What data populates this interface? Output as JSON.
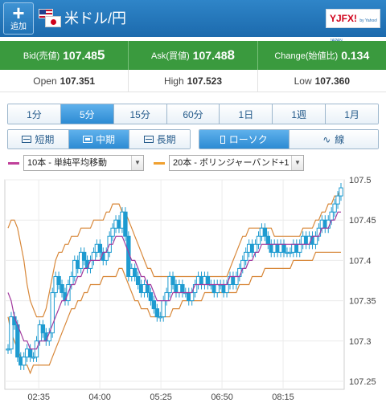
{
  "header": {
    "add_label": "追加",
    "add_glyph": "+",
    "pair": "米ドル/円",
    "logo_text": "YJFX!",
    "logo_small": "by Yahoo! JAPAN"
  },
  "prices": {
    "bid_label": "Bid(売値)",
    "bid_main": "107.48",
    "bid_pip": "5",
    "ask_label": "Ask(買値)",
    "ask_main": "107.48",
    "ask_pip": "8",
    "change_label": "Change(始値比)",
    "change_value": "0.134"
  },
  "ohl": {
    "open_label": "Open",
    "open_main": "107.35",
    "open_pip": "1",
    "high_label": "High",
    "high_main": "107.52",
    "high_pip": "3",
    "low_label": "Low",
    "low_main": "107.36",
    "low_pip": "0"
  },
  "timeframes": [
    "1分",
    "5分",
    "15分",
    "60分",
    "1日",
    "1週",
    "1月"
  ],
  "timeframe_selected": "5分",
  "periods": [
    "短期",
    "中期",
    "長期"
  ],
  "period_selected": "中期",
  "chart_types": [
    "ローソク",
    "線"
  ],
  "chart_type_selected": "ローソク",
  "indicators": [
    {
      "label": "10本 - 単純平均移動",
      "color": "#c0409a"
    },
    {
      "label": "20本 - ボリンジャーバンド+1",
      "color": "#f0a030"
    }
  ],
  "colors": {
    "accent_blue": "#2d8bd3",
    "price_green": "#3a9a3e",
    "candle": "#1e9bd0",
    "sma": "#a23a9e",
    "band": "#d8883a"
  },
  "chart_data": {
    "type": "candlestick",
    "title": "",
    "x_labels": [
      "02:35",
      "04:00",
      "05:25",
      "06:50",
      "08:15"
    ],
    "y_ticks": [
      107.25,
      107.3,
      107.35,
      107.4,
      107.45,
      107.5
    ],
    "ylim": [
      107.24,
      107.5
    ],
    "grid": true,
    "close": [
      107.29,
      107.33,
      107.32,
      107.28,
      107.27,
      107.28,
      107.29,
      107.28,
      107.28,
      107.3,
      107.32,
      107.31,
      107.3,
      107.31,
      107.36,
      107.38,
      107.37,
      107.36,
      107.35,
      107.37,
      107.38,
      107.4,
      107.39,
      107.41,
      107.4,
      107.39,
      107.4,
      107.41,
      107.42,
      107.41,
      107.4,
      107.41,
      107.43,
      107.44,
      107.45,
      107.44,
      107.46,
      107.43,
      107.38,
      107.39,
      107.38,
      107.37,
      107.36,
      107.37,
      107.36,
      107.35,
      107.34,
      107.33,
      107.33,
      107.35,
      107.36,
      107.38,
      107.37,
      107.36,
      107.37,
      107.36,
      107.36,
      107.35,
      107.36,
      107.37,
      107.38,
      107.37,
      107.38,
      107.37,
      107.37,
      107.36,
      107.37,
      107.37,
      107.36,
      107.37,
      107.38,
      107.37,
      107.38,
      107.39,
      107.4,
      107.41,
      107.42,
      107.41,
      107.42,
      107.43,
      107.44,
      107.43,
      107.42,
      107.41,
      107.42,
      107.41,
      107.42,
      107.41,
      107.41,
      107.41,
      107.42,
      107.41,
      107.42,
      107.43,
      107.42,
      107.43,
      107.42,
      107.43,
      107.44,
      107.45,
      107.44,
      107.45,
      107.46,
      107.47,
      107.48,
      107.49
    ],
    "sma": [
      107.36,
      107.35,
      107.33,
      107.32,
      107.31,
      107.3,
      107.3,
      107.29,
      107.29,
      107.29,
      107.3,
      107.3,
      107.3,
      107.31,
      107.32,
      107.33,
      107.34,
      107.35,
      107.35,
      107.36,
      107.37,
      107.37,
      107.38,
      107.38,
      107.39,
      107.39,
      107.4,
      107.4,
      107.4,
      107.4,
      107.41,
      107.41,
      107.42,
      107.42,
      107.43,
      107.43,
      107.43,
      107.42,
      107.41,
      107.4,
      107.4,
      107.39,
      107.38,
      107.38,
      107.37,
      107.37,
      107.36,
      107.35,
      107.35,
      107.35,
      107.35,
      107.35,
      107.36,
      107.36,
      107.36,
      107.36,
      107.36,
      107.36,
      107.36,
      107.37,
      107.37,
      107.37,
      107.37,
      107.37,
      107.37,
      107.37,
      107.37,
      107.37,
      107.37,
      107.37,
      107.38,
      107.38,
      107.38,
      107.38,
      107.39,
      107.39,
      107.4,
      107.4,
      107.41,
      107.41,
      107.42,
      107.42,
      107.42,
      107.42,
      107.42,
      107.42,
      107.42,
      107.42,
      107.42,
      107.42,
      107.42,
      107.42,
      107.42,
      107.42,
      107.42,
      107.42,
      107.43,
      107.43,
      107.43,
      107.44,
      107.44,
      107.44,
      107.45,
      107.45,
      107.46,
      107.46
    ],
    "band_upper": [
      107.44,
      107.45,
      107.45,
      107.44,
      107.42,
      107.4,
      107.37,
      107.35,
      107.34,
      107.33,
      107.33,
      107.33,
      107.34,
      107.36,
      107.38,
      107.4,
      107.41,
      107.41,
      107.42,
      107.42,
      107.43,
      107.43,
      107.43,
      107.44,
      107.44,
      107.44,
      107.44,
      107.45,
      107.45,
      107.45,
      107.45,
      107.46,
      107.46,
      107.47,
      107.47,
      107.47,
      107.46,
      107.46,
      107.45,
      107.44,
      107.43,
      107.42,
      107.41,
      107.4,
      107.39,
      107.39,
      107.38,
      107.38,
      107.38,
      107.38,
      107.38,
      107.38,
      107.38,
      107.38,
      107.38,
      107.38,
      107.38,
      107.38,
      107.38,
      107.38,
      107.38,
      107.38,
      107.38,
      107.38,
      107.38,
      107.38,
      107.38,
      107.38,
      107.38,
      107.38,
      107.39,
      107.4,
      107.41,
      107.42,
      107.43,
      107.43,
      107.44,
      107.44,
      107.44,
      107.44,
      107.44,
      107.44,
      107.44,
      107.44,
      107.43,
      107.43,
      107.43,
      107.43,
      107.43,
      107.43,
      107.43,
      107.43,
      107.43,
      107.44,
      107.44,
      107.44,
      107.44,
      107.45,
      107.45,
      107.46,
      107.46,
      107.47,
      107.47,
      107.48,
      107.48,
      107.49
    ],
    "band_lower": [
      107.33,
      107.31,
      107.3,
      107.29,
      107.28,
      107.27,
      107.27,
      107.26,
      107.27,
      107.27,
      107.27,
      107.27,
      107.27,
      107.27,
      107.28,
      107.29,
      107.3,
      107.31,
      107.32,
      107.33,
      107.34,
      107.34,
      107.35,
      107.35,
      107.36,
      107.36,
      107.37,
      107.37,
      107.37,
      107.37,
      107.38,
      107.38,
      107.38,
      107.38,
      107.38,
      107.39,
      107.39,
      107.38,
      107.37,
      107.36,
      107.35,
      107.35,
      107.34,
      107.34,
      107.34,
      107.33,
      107.33,
      107.33,
      107.33,
      107.33,
      107.33,
      107.33,
      107.34,
      107.34,
      107.34,
      107.35,
      107.35,
      107.35,
      107.35,
      107.35,
      107.35,
      107.35,
      107.36,
      107.36,
      107.36,
      107.36,
      107.36,
      107.36,
      107.36,
      107.36,
      107.36,
      107.36,
      107.36,
      107.37,
      107.37,
      107.37,
      107.37,
      107.38,
      107.38,
      107.38,
      107.38,
      107.39,
      107.39,
      107.39,
      107.39,
      107.39,
      107.39,
      107.39,
      107.39,
      107.39,
      107.4,
      107.4,
      107.4,
      107.4,
      107.4,
      107.4,
      107.4,
      107.41,
      107.41,
      107.41,
      107.41,
      107.41,
      107.41,
      107.41,
      107.41,
      107.41
    ]
  }
}
